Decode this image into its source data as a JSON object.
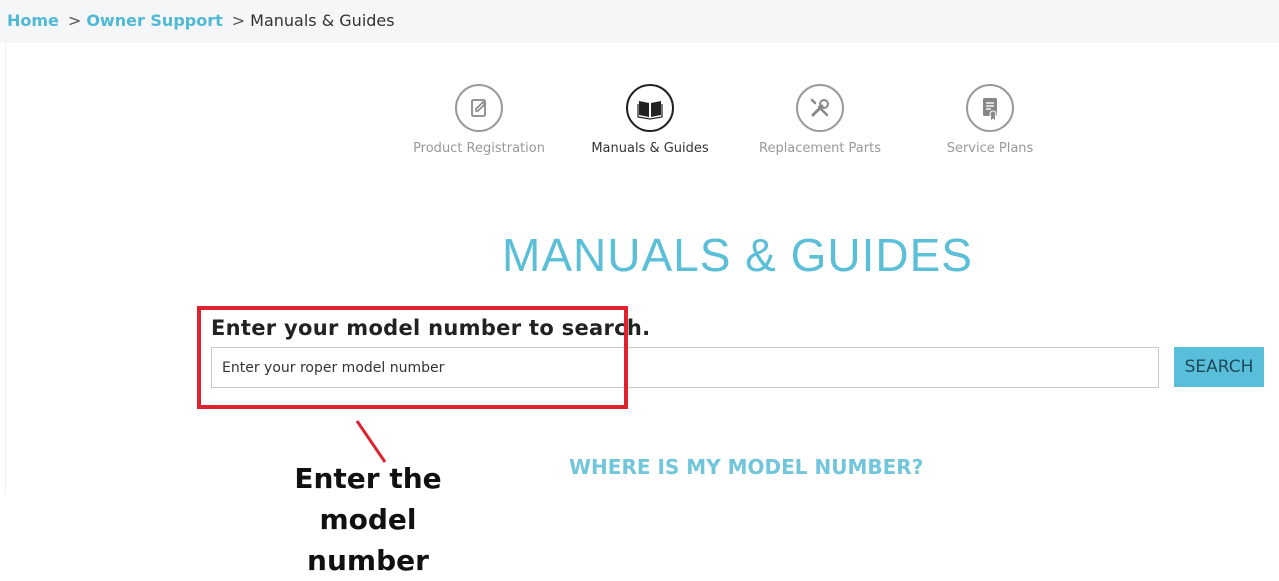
{
  "breadcrumb": {
    "home": "Home",
    "owner_support": "Owner Support",
    "current": "Manuals & Guides",
    "separator": ">"
  },
  "nav": {
    "items": [
      {
        "label": "Product Registration",
        "icon": "edit-document-icon"
      },
      {
        "label": "Manuals & Guides",
        "icon": "open-book-icon",
        "active": true
      },
      {
        "label": "Replacement Parts",
        "icon": "wrench-screwdriver-icon"
      },
      {
        "label": "Service Plans",
        "icon": "document-badge-icon"
      }
    ]
  },
  "main": {
    "title": "MANUALS & GUIDES",
    "search_prompt": "Enter your model number to search.",
    "search_placeholder": "Enter your roper model number",
    "search_button": "SEARCH",
    "where_link": "WHERE IS MY MODEL NUMBER?"
  },
  "annotation": {
    "line1": "Enter the model",
    "line2": "number"
  },
  "colors": {
    "accent": "#5bbfd7",
    "button": "#59bed9",
    "highlight": "#e0212e"
  }
}
